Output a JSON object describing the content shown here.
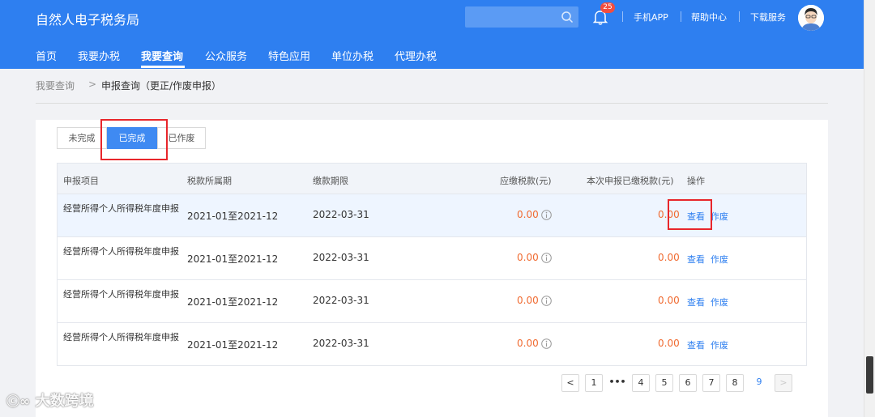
{
  "header": {
    "app_title": "自然人电子税务局",
    "search_placeholder": "",
    "notification_count": "25",
    "links": [
      "手机APP",
      "帮助中心",
      "下载服务"
    ]
  },
  "nav": {
    "items": [
      "首页",
      "我要办税",
      "我要查询",
      "公众服务",
      "特色应用",
      "单位办税",
      "代理办税"
    ],
    "active": "我要查询"
  },
  "breadcrumb": {
    "root": "我要查询",
    "separator": ">",
    "current": "申报查询（更正/作废申报）"
  },
  "tabs": [
    "未完成",
    "已完成",
    "已作废"
  ],
  "active_tab": "已完成",
  "table": {
    "headers": [
      "申报项目",
      "税款所属期",
      "缴款期限",
      "应缴税款(元)",
      "本次申报已缴税款(元)",
      "操作"
    ],
    "rows": [
      {
        "name": "经营所得个人所得税年度申报",
        "period": "2021-01至2021-12",
        "deadline": "2022-03-31",
        "due": "0.00",
        "paid": "0.00",
        "view": "查看",
        "void": "作废"
      },
      {
        "name": "经营所得个人所得税年度申报",
        "period": "2021-01至2021-12",
        "deadline": "2022-03-31",
        "due": "0.00",
        "paid": "0.00",
        "view": "查看",
        "void": "作废"
      },
      {
        "name": "经营所得个人所得税年度申报",
        "period": "2021-01至2021-12",
        "deadline": "2022-03-31",
        "due": "0.00",
        "paid": "0.00",
        "view": "查看",
        "void": "作废"
      },
      {
        "name": "经营所得个人所得税年度申报",
        "period": "2021-01至2021-12",
        "deadline": "2022-03-31",
        "due": "0.00",
        "paid": "0.00",
        "view": "查看",
        "void": "作废"
      }
    ]
  },
  "pagination": {
    "prev": "<",
    "pages": [
      "1",
      "•••",
      "4",
      "5",
      "6",
      "7",
      "8",
      "9"
    ],
    "current": "9",
    "next": ">"
  },
  "watermark": "大数跨境",
  "colors": {
    "brand": "#2e7ff0",
    "accent_money": "#f06a30",
    "highlight_box": "#e8262b"
  },
  "icons": {
    "search": "search-icon",
    "bell": "bell-icon",
    "info": "info-circle-icon",
    "avatar": "user-avatar"
  }
}
